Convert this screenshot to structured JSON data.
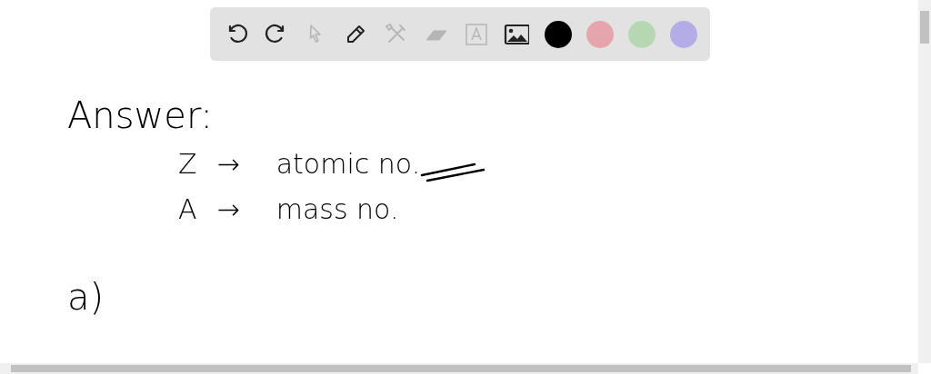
{
  "toolbar": {
    "tools": [
      {
        "kind": "undo",
        "disabled": false
      },
      {
        "kind": "redo",
        "disabled": false
      },
      {
        "kind": "pointer",
        "disabled": true
      },
      {
        "kind": "pen",
        "disabled": false
      },
      {
        "kind": "tools",
        "disabled": true
      },
      {
        "kind": "eraser",
        "disabled": true
      },
      {
        "kind": "text",
        "disabled": true
      },
      {
        "kind": "image",
        "disabled": false
      }
    ],
    "colors": [
      {
        "color": "#000000"
      },
      {
        "color": "#e6a5ac"
      },
      {
        "color": "#b5d8b3"
      },
      {
        "color": "#b3ace6"
      }
    ]
  },
  "board": {
    "heading": "Answer:",
    "definitions": [
      {
        "symbol": "Z",
        "arrow": "→",
        "meaning": "atomic no.",
        "underlined": true
      },
      {
        "symbol": "A",
        "arrow": "→",
        "meaning": "mass no.",
        "underlined": false
      }
    ],
    "part_label": "a)"
  }
}
